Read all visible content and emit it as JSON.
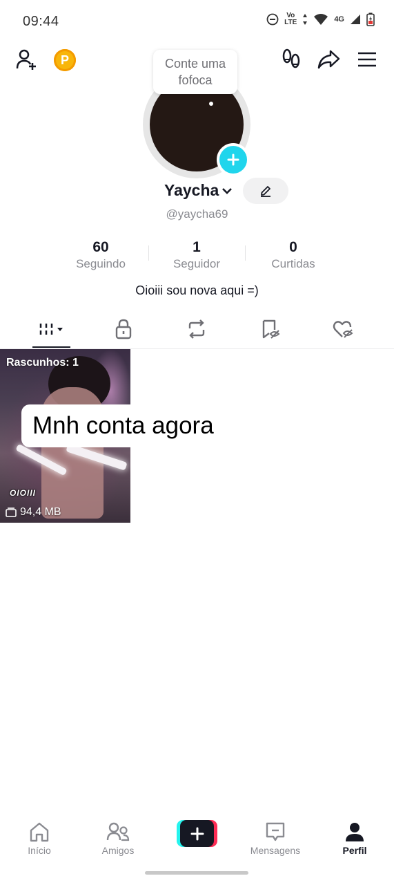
{
  "status_bar": {
    "time": "09:44",
    "volte_top": "Vo",
    "volte_bottom": "LTE",
    "network": "4G",
    "icons": [
      "do-not-disturb-icon",
      "volte-icon",
      "data-arrows-icon",
      "wifi-icon",
      "signal-icon",
      "battery-charging-icon"
    ]
  },
  "top_bar": {
    "icons": [
      "add-friend-icon",
      "coin-icon",
      "footprints-icon",
      "share-icon",
      "menu-icon"
    ],
    "coin_letter": "P"
  },
  "profile": {
    "tooltip_text": "Conte uma fofoca",
    "username": "Yaycha",
    "handle": "@yaycha69",
    "bio": "Oioiii sou nova aqui =)"
  },
  "stats": [
    {
      "value": "60",
      "label": "Seguindo"
    },
    {
      "value": "1",
      "label": "Seguidor"
    },
    {
      "value": "0",
      "label": "Curtidas"
    }
  ],
  "tabs": [
    {
      "icon": "grid-icon",
      "active": true
    },
    {
      "icon": "lock-icon",
      "active": false
    },
    {
      "icon": "repost-icon",
      "active": false
    },
    {
      "icon": "hidden-bookmark-icon",
      "active": false
    },
    {
      "icon": "hidden-heart-icon",
      "active": false
    }
  ],
  "draft_tile": {
    "label": "Rascunhos: 1",
    "overlay_tag": "OIOIII",
    "size": "94,4 MB"
  },
  "caption": "Mnh conta agora",
  "bottom_nav": {
    "items": [
      {
        "label": "Início",
        "icon": "home-icon",
        "active": false
      },
      {
        "label": "Amigos",
        "icon": "friends-icon",
        "active": false
      },
      {
        "label": "",
        "icon": "plus-icon",
        "active": false
      },
      {
        "label": "Mensagens",
        "icon": "inbox-icon",
        "active": false
      },
      {
        "label": "Perfil",
        "icon": "profile-icon",
        "active": true
      }
    ]
  },
  "colors": {
    "accent_cyan": "#20d5ec",
    "accent_red": "#fe2c55",
    "coin": "#f8b60b",
    "text_primary": "#161823",
    "text_secondary": "#8a8b91"
  }
}
